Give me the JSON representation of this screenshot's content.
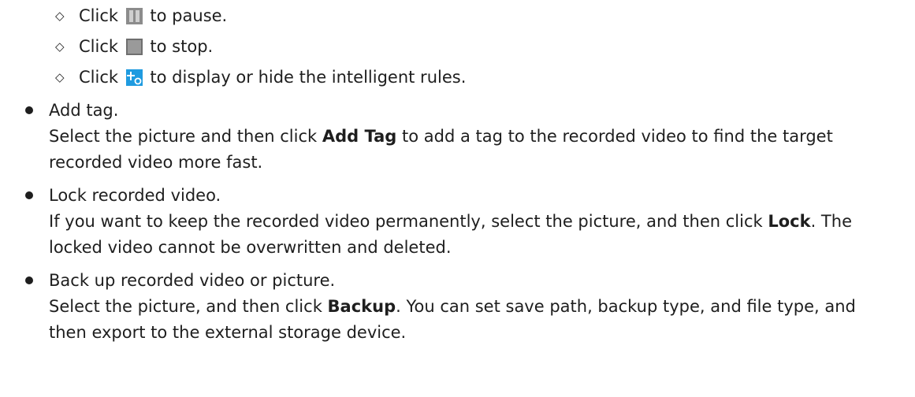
{
  "sub_items": [
    {
      "prefix": "Click",
      "suffix": "to pause.",
      "icon": "pause-icon"
    },
    {
      "prefix": "Click",
      "suffix": "to stop.",
      "icon": "stop-icon"
    },
    {
      "prefix": "Click",
      "suffix": "to display or hide the intelligent rules.",
      "icon": "intelligent-rules-icon"
    }
  ],
  "items": [
    {
      "title": "Add tag.",
      "line1_pre": "Select the picture and then click ",
      "line1_bold": "Add Tag",
      "line1_post": " to add a tag to the recorded video to find the target",
      "line2": "recorded video more fast."
    },
    {
      "title": "Lock recorded video.",
      "line1_pre": "If you want to keep the recorded video permanently, select the picture, and then click ",
      "line1_bold": "Lock",
      "line1_post": ". The",
      "line2": "locked video cannot be overwritten and deleted."
    },
    {
      "title": "Back up recorded video or picture.",
      "line1_pre": "Select the picture, and then click ",
      "line1_bold": "Backup",
      "line1_post": ". You can set save path, backup type, and file type, and",
      "line2": "then export to the external storage device."
    }
  ]
}
